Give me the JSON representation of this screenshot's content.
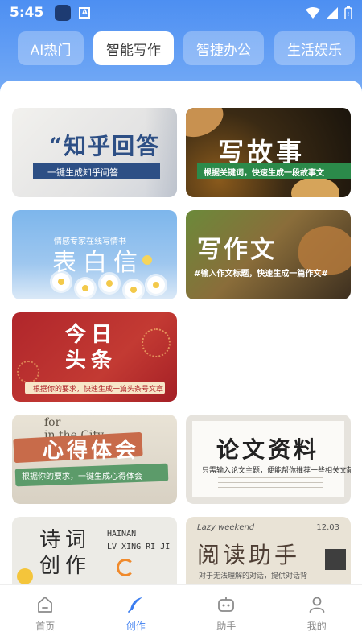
{
  "status_bar": {
    "time": "5:45",
    "notif_letter": "A"
  },
  "tabs": [
    {
      "label": "AI热门",
      "active": false
    },
    {
      "label": "智能写作",
      "active": true
    },
    {
      "label": "智捷办公",
      "active": false
    },
    {
      "label": "生活娱乐",
      "active": false
    }
  ],
  "cards": {
    "zhihu": {
      "title": "“知乎回答",
      "subtitle": "一键生成知乎问答"
    },
    "story": {
      "title": "写故事",
      "subtitle": "根据关键词，快速生成一段故事文"
    },
    "love_letter": {
      "title": "表白信",
      "subtitle": "情感专家在线写情书"
    },
    "essay": {
      "title": "写作文",
      "subtitle": "#输入作文标题，快速生成一篇作文#"
    },
    "toutiao": {
      "title_line1": "今日",
      "title_line2": "头条",
      "subtitle": "根据你的要求，快速生成一篇头条号文章"
    },
    "reflection": {
      "title": "心得体会",
      "subtitle": "根据你的要求，一键生成心得体会",
      "newspaper_text": "for\nin the City\nstart"
    },
    "thesis": {
      "title": "论文资料",
      "subtitle": "只需输入论文主题，便能帮你推荐一些相关文献"
    },
    "poetry": {
      "title_line1": "诗词",
      "title_line2": "创作",
      "english_text": "HAINAN\nLV XING RI JI"
    },
    "reading": {
      "title": "阅读助手",
      "english_left": "Lazy weekend",
      "english_right": "12.03",
      "subtitle": "对于无法理解的对话，提供对话背"
    }
  },
  "bottom_nav": [
    {
      "label": "首页",
      "icon": "home-icon",
      "active": false
    },
    {
      "label": "创作",
      "icon": "feather-icon",
      "active": true
    },
    {
      "label": "助手",
      "icon": "robot-icon",
      "active": false
    },
    {
      "label": "我的",
      "icon": "person-icon",
      "active": false
    }
  ],
  "colors": {
    "accent": "#3c7ef0",
    "header_blue": "#4d8ff2",
    "inactive": "#8a8a8a"
  }
}
